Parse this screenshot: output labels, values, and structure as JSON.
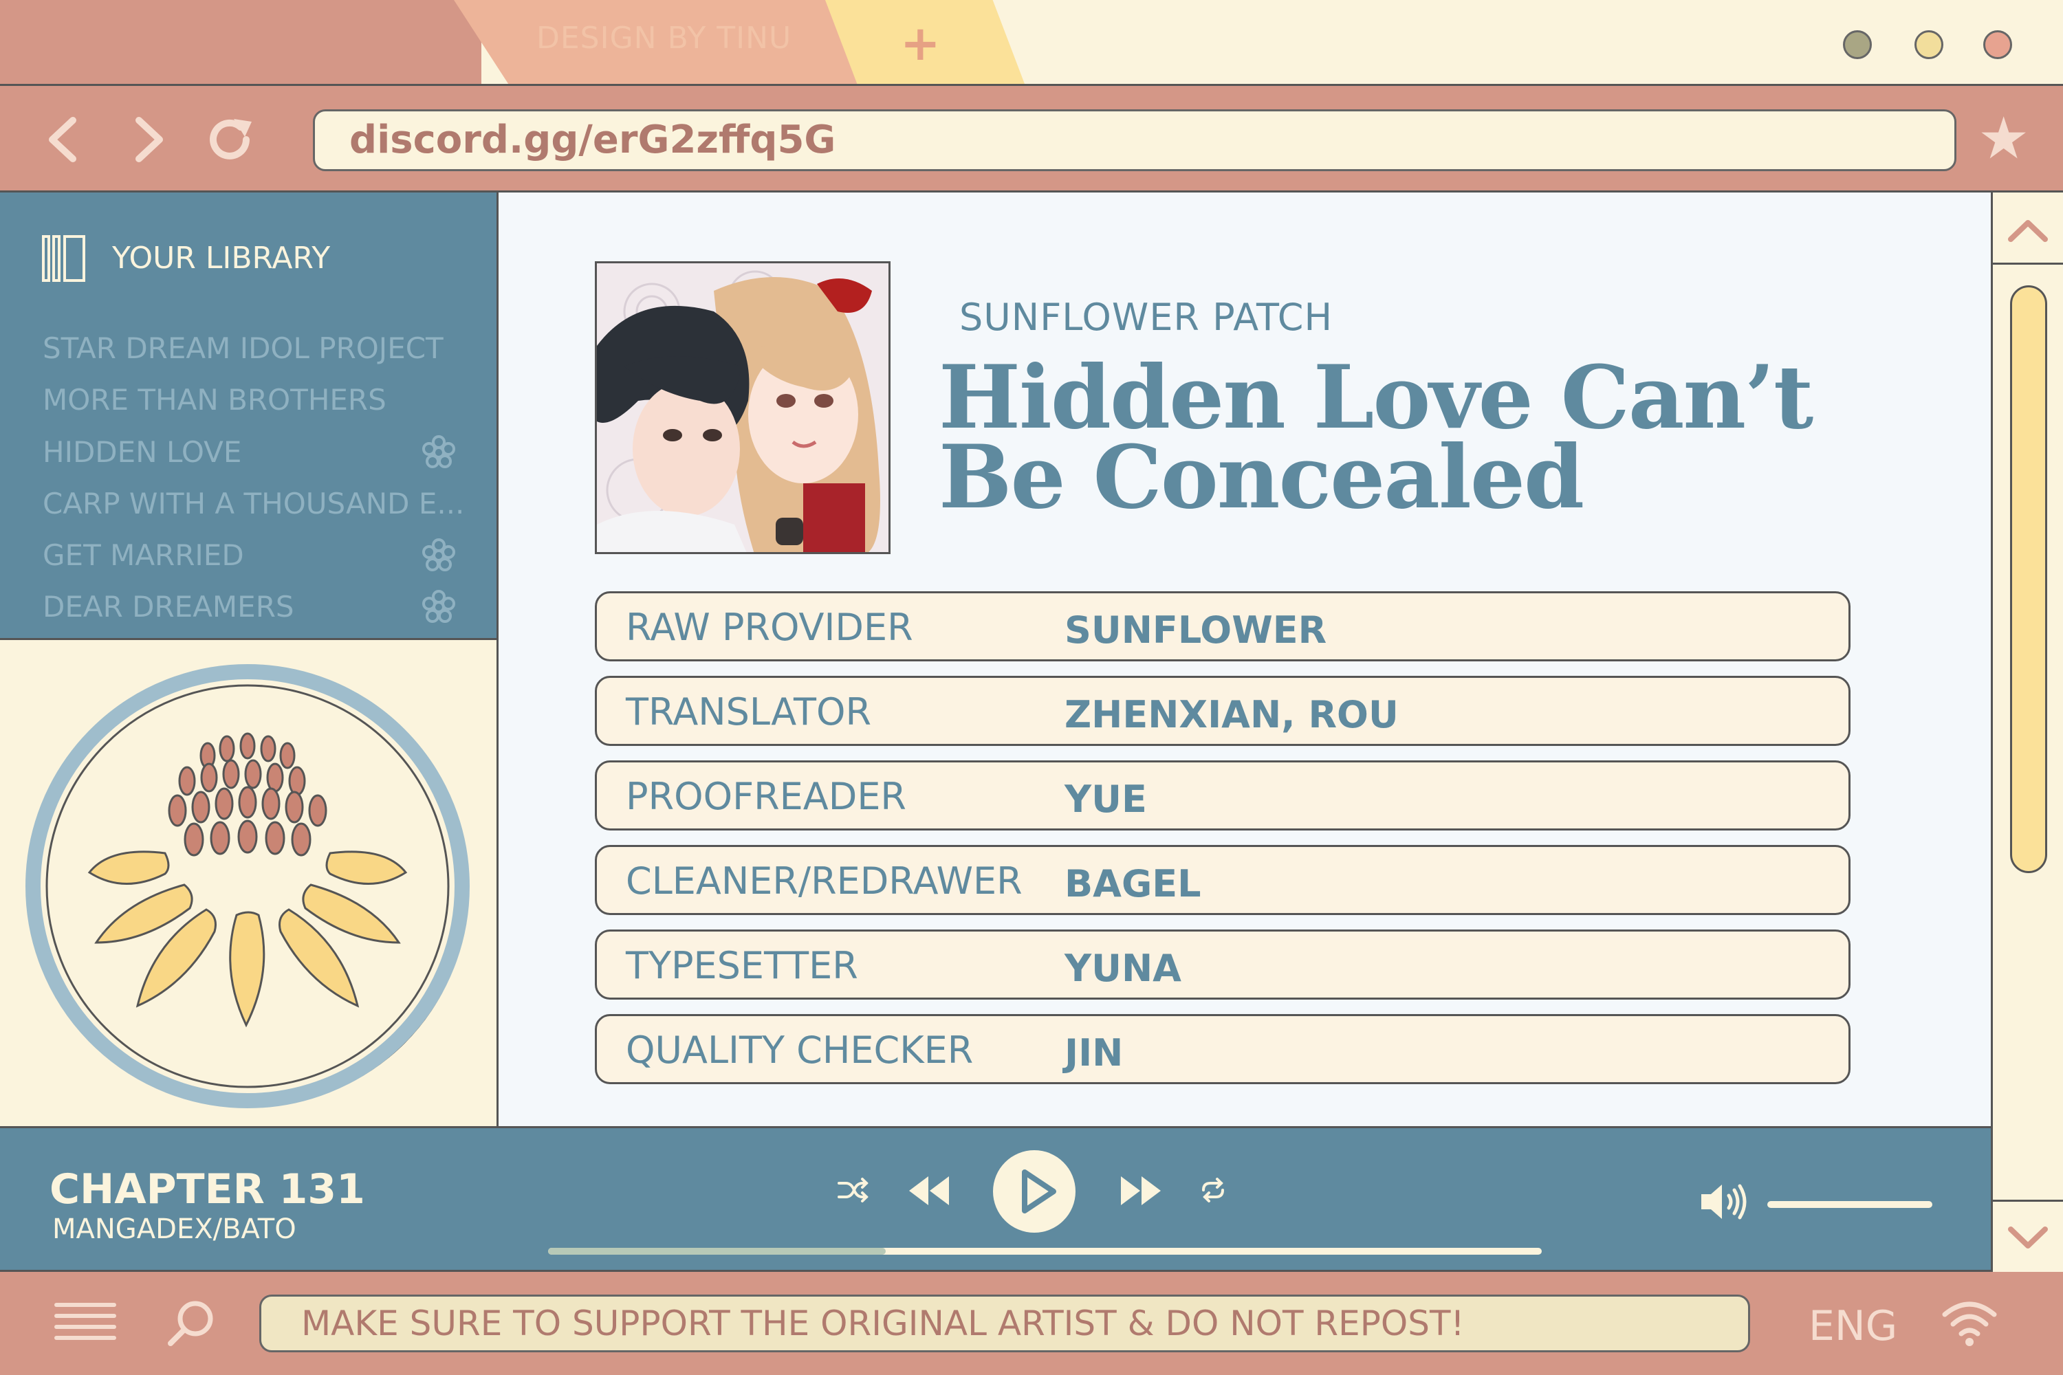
{
  "tabs": {
    "active_label": "DESIGN BY TINU",
    "new_tab_icon": "plus-icon"
  },
  "window_controls": {
    "colors": [
      "#a9a684",
      "#f2de9c",
      "#e7a390"
    ]
  },
  "navigation": {
    "back_icon": "chevron-left-icon",
    "forward_icon": "chevron-right-icon",
    "refresh_icon": "refresh-icon",
    "address": "discord.gg/erG2zffq5G",
    "bookmark_icon": "star-icon"
  },
  "library": {
    "title": "YOUR LIBRARY",
    "items": [
      {
        "label": "STAR DREAM IDOL PROJECT",
        "favorite": false
      },
      {
        "label": "MORE THAN BROTHERS",
        "favorite": false
      },
      {
        "label": "HIDDEN LOVE",
        "favorite": true
      },
      {
        "label": "CARP WITH A THOUSAND E...",
        "favorite": false
      },
      {
        "label": "GET MARRIED",
        "favorite": true
      },
      {
        "label": "DEAR DREAMERS",
        "favorite": true
      }
    ]
  },
  "series": {
    "group": "SUNFLOWER PATCH",
    "title_line1": "Hidden Love Can’t",
    "title_line2": "Be Concealed"
  },
  "credits": [
    {
      "role": "RAW PROVIDER",
      "name": "SUNFLOWER"
    },
    {
      "role": "TRANSLATOR",
      "name": "ZHENXIAN, ROU"
    },
    {
      "role": "PROOFREADER",
      "name": "YUE"
    },
    {
      "role": "CLEANER/REDRAWER",
      "name": "BAGEL"
    },
    {
      "role": "TYPESETTER",
      "name": "YUNA"
    },
    {
      "role": "QUALITY CHECKER",
      "name": "JIN"
    }
  ],
  "player": {
    "chapter": "CHAPTER 131",
    "source": "MANGADEX/BATO",
    "progress": 0.34
  },
  "bottom": {
    "notice": "MAKE SURE TO SUPPORT THE ORIGINAL ARTIST & DO NOT REPOST!",
    "language": "ENG"
  },
  "colors": {
    "rose": "#d49787",
    "cream": "#fbf4dd",
    "teal": "#5f8a9f",
    "butter": "#fbe199",
    "peach": "#edb499"
  }
}
